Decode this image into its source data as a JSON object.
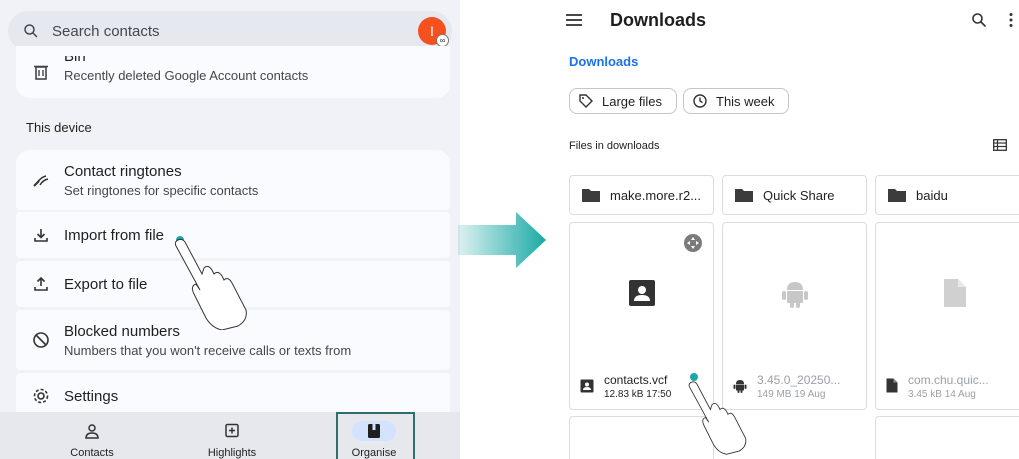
{
  "contacts": {
    "search_placeholder": "Search contacts",
    "avatar_letter": "I",
    "bin": {
      "title": "Bin",
      "subtitle": "Recently deleted Google Account contacts"
    },
    "section": "This device",
    "items": [
      {
        "title": "Contact ringtones",
        "subtitle": "Set ringtones for specific contacts"
      },
      {
        "title": "Import from file"
      },
      {
        "title": "Export to file"
      },
      {
        "title": "Blocked numbers",
        "subtitle": "Numbers that you won't receive calls or texts from"
      },
      {
        "title": "Settings"
      }
    ],
    "nav": [
      "Contacts",
      "Highlights",
      "Organise"
    ],
    "active_nav": "Organise"
  },
  "files": {
    "title": "Downloads",
    "breadcrumb": "Downloads",
    "chips": [
      "Large files",
      "This week"
    ],
    "section": "Files in downloads",
    "folders": [
      "make.more.r2...",
      "Quick Share",
      "baidu"
    ],
    "tiles": [
      {
        "name": "contacts.vcf",
        "meta": "12.83 kB 17:50",
        "icon": "contact-card-icon"
      },
      {
        "name": "3.45.0_20250...",
        "meta": "149 MB 19 Aug",
        "icon": "android-icon"
      },
      {
        "name": "com.chu.quic...",
        "meta": "3.45 kB 14 Aug",
        "icon": "file-icon"
      }
    ]
  },
  "colors": {
    "accent": "#1a73e8",
    "arrow": "#1ba9a6",
    "avatar": "#f4511e",
    "highlight": "#2f6f6a"
  }
}
